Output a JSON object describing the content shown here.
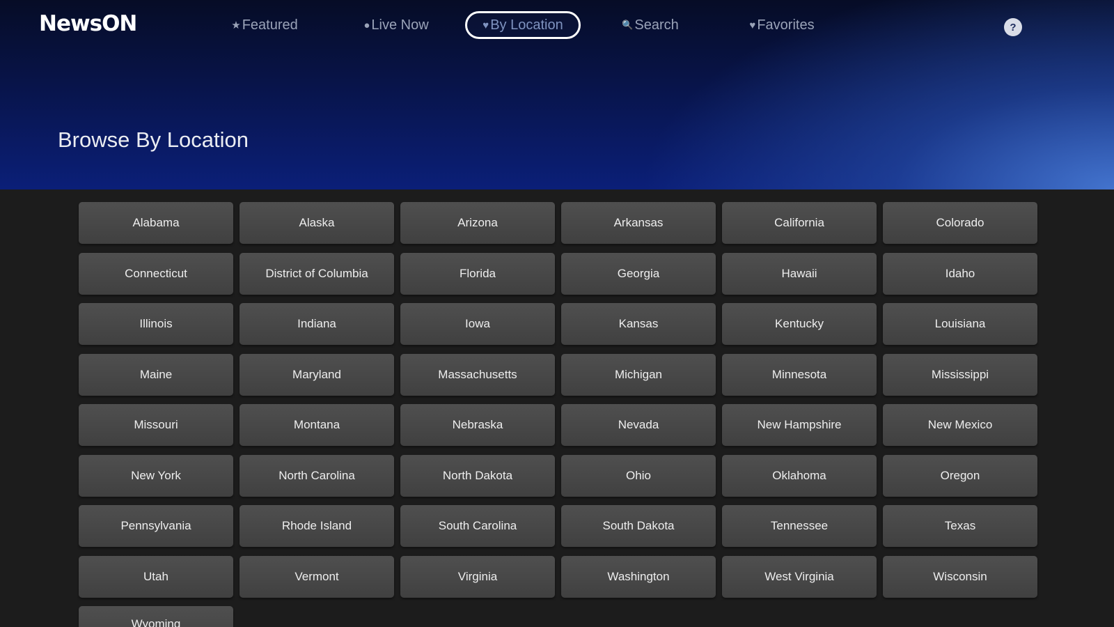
{
  "app": {
    "logo": {
      "part1": "News",
      "part2": "s",
      "part3": "ON"
    }
  },
  "nav": {
    "items": [
      {
        "label": "Featured",
        "icon": "star-icon",
        "glyph": "★",
        "active": false
      },
      {
        "label": "Live Now",
        "icon": "live-dot-icon",
        "glyph": "●",
        "active": false
      },
      {
        "label": "By Location",
        "icon": "location-pin-icon",
        "glyph": "♥",
        "active": true
      },
      {
        "label": "Search",
        "icon": "search-icon",
        "glyph": "🔍",
        "active": false
      },
      {
        "label": "Favorites",
        "icon": "heart-icon",
        "glyph": "♥",
        "active": false
      }
    ],
    "help": {
      "label": "?",
      "icon": "help-icon"
    }
  },
  "page": {
    "title": "Browse By Location"
  },
  "locations": [
    "Alabama",
    "Alaska",
    "Arizona",
    "Arkansas",
    "California",
    "Colorado",
    "Connecticut",
    "District of Columbia",
    "Florida",
    "Georgia",
    "Hawaii",
    "Idaho",
    "Illinois",
    "Indiana",
    "Iowa",
    "Kansas",
    "Kentucky",
    "Louisiana",
    "Maine",
    "Maryland",
    "Massachusetts",
    "Michigan",
    "Minnesota",
    "Mississippi",
    "Missouri",
    "Montana",
    "Nebraska",
    "Nevada",
    "New Hampshire",
    "New Mexico",
    "New York",
    "North Carolina",
    "North Dakota",
    "Ohio",
    "Oklahoma",
    "Oregon",
    "Pennsylvania",
    "Rhode Island",
    "South Carolina",
    "South Dakota",
    "Tennessee",
    "Texas",
    "Utah",
    "Vermont",
    "Virginia",
    "Washington",
    "West Virginia",
    "Wisconsin",
    "Wyoming"
  ]
}
